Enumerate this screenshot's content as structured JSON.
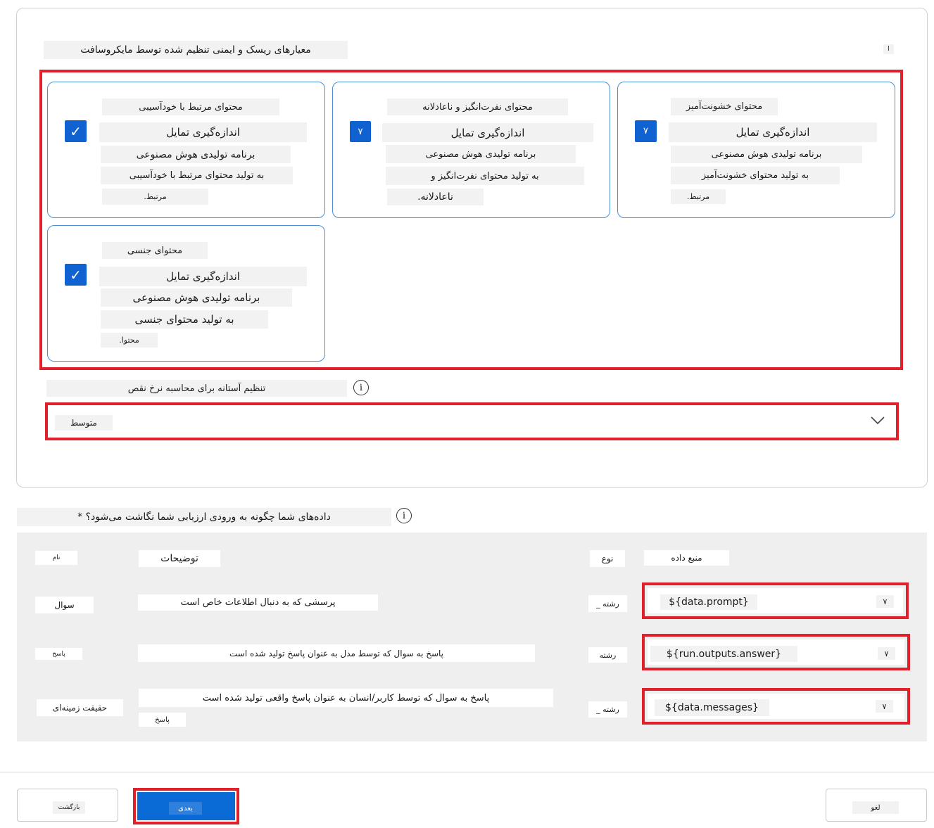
{
  "section": {
    "title": "معیارهای ریسک و ایمنی تنظیم شده توسط مایکروسافت",
    "corner_mark": "ا"
  },
  "cards": [
    {
      "title": "محتوای خشونت‌آمیز",
      "lines": [
        "اندازه‌گیری تمایل",
        "برنامه تولیدی هوش مصنوعی",
        "به تولید محتوای خشونت‌آمیز",
        "مرتبط."
      ],
      "checked": true,
      "check_glyph": "٧"
    },
    {
      "title": "محتوای نفرت‌انگیز و ناعادلانه",
      "lines": [
        "اندازه‌گیری تمایل",
        "برنامه تولیدی هوش مصنوعی",
        "به تولید محتوای نفرت‌انگیز و",
        "ناعادلانه."
      ],
      "checked": true,
      "check_glyph": "٧"
    },
    {
      "title": "محتوای مرتبط با خودآسیبی",
      "lines": [
        "اندازه‌گیری تمایل",
        "برنامه تولیدی هوش مصنوعی",
        "به تولید محتوای مرتبط با خودآسیبی",
        "مرتبط."
      ],
      "checked": true,
      "check_glyph": "✓"
    },
    {
      "title": "محتوای جنسی",
      "lines": [
        "اندازه‌گیری تمایل",
        "برنامه تولیدی هوش مصنوعی",
        "به تولید محتوای جنسی",
        "محتوا."
      ],
      "checked": true,
      "check_glyph": "✓"
    }
  ],
  "threshold": {
    "label": "تنظیم آستانه برای محاسبه نرخ نقص",
    "value": "متوسط"
  },
  "mapping": {
    "question": "داده‌های شما چگونه به ورودی ارزیابی شما نگاشت می‌شود؟ *",
    "headers": {
      "name": "نام",
      "description": "توضیحات",
      "type": "نوع",
      "source": "منبع داده"
    },
    "rows": [
      {
        "name": "سوال",
        "description": "پرسشی که به دنبال اطلاعات خاص است",
        "type": "رشته _",
        "source": "${data.prompt}",
        "caret": "٧"
      },
      {
        "name": "پاسخ",
        "description": "پاسخ به سوال که توسط مدل به عنوان پاسخ تولید شده است",
        "type": "رشته",
        "source": "${run.outputs.answer}",
        "caret": "٧"
      },
      {
        "name": "حقیقت زمینه‌ای",
        "description": "پاسخ به سوال که توسط کاربر/انسان به عنوان پاسخ واقعی تولید شده است",
        "description2": "پاسخ",
        "type": "رشته _",
        "source": "${data.messages}",
        "caret": "٧"
      }
    ]
  },
  "footer": {
    "back": "بازگشت",
    "next": "بعدی",
    "cancel": "لغو"
  },
  "colors": {
    "accent": "#0f62d0",
    "highlight": "#e0202a",
    "card_border": "#4a8fd8",
    "next_button": "#0a6bd6"
  }
}
